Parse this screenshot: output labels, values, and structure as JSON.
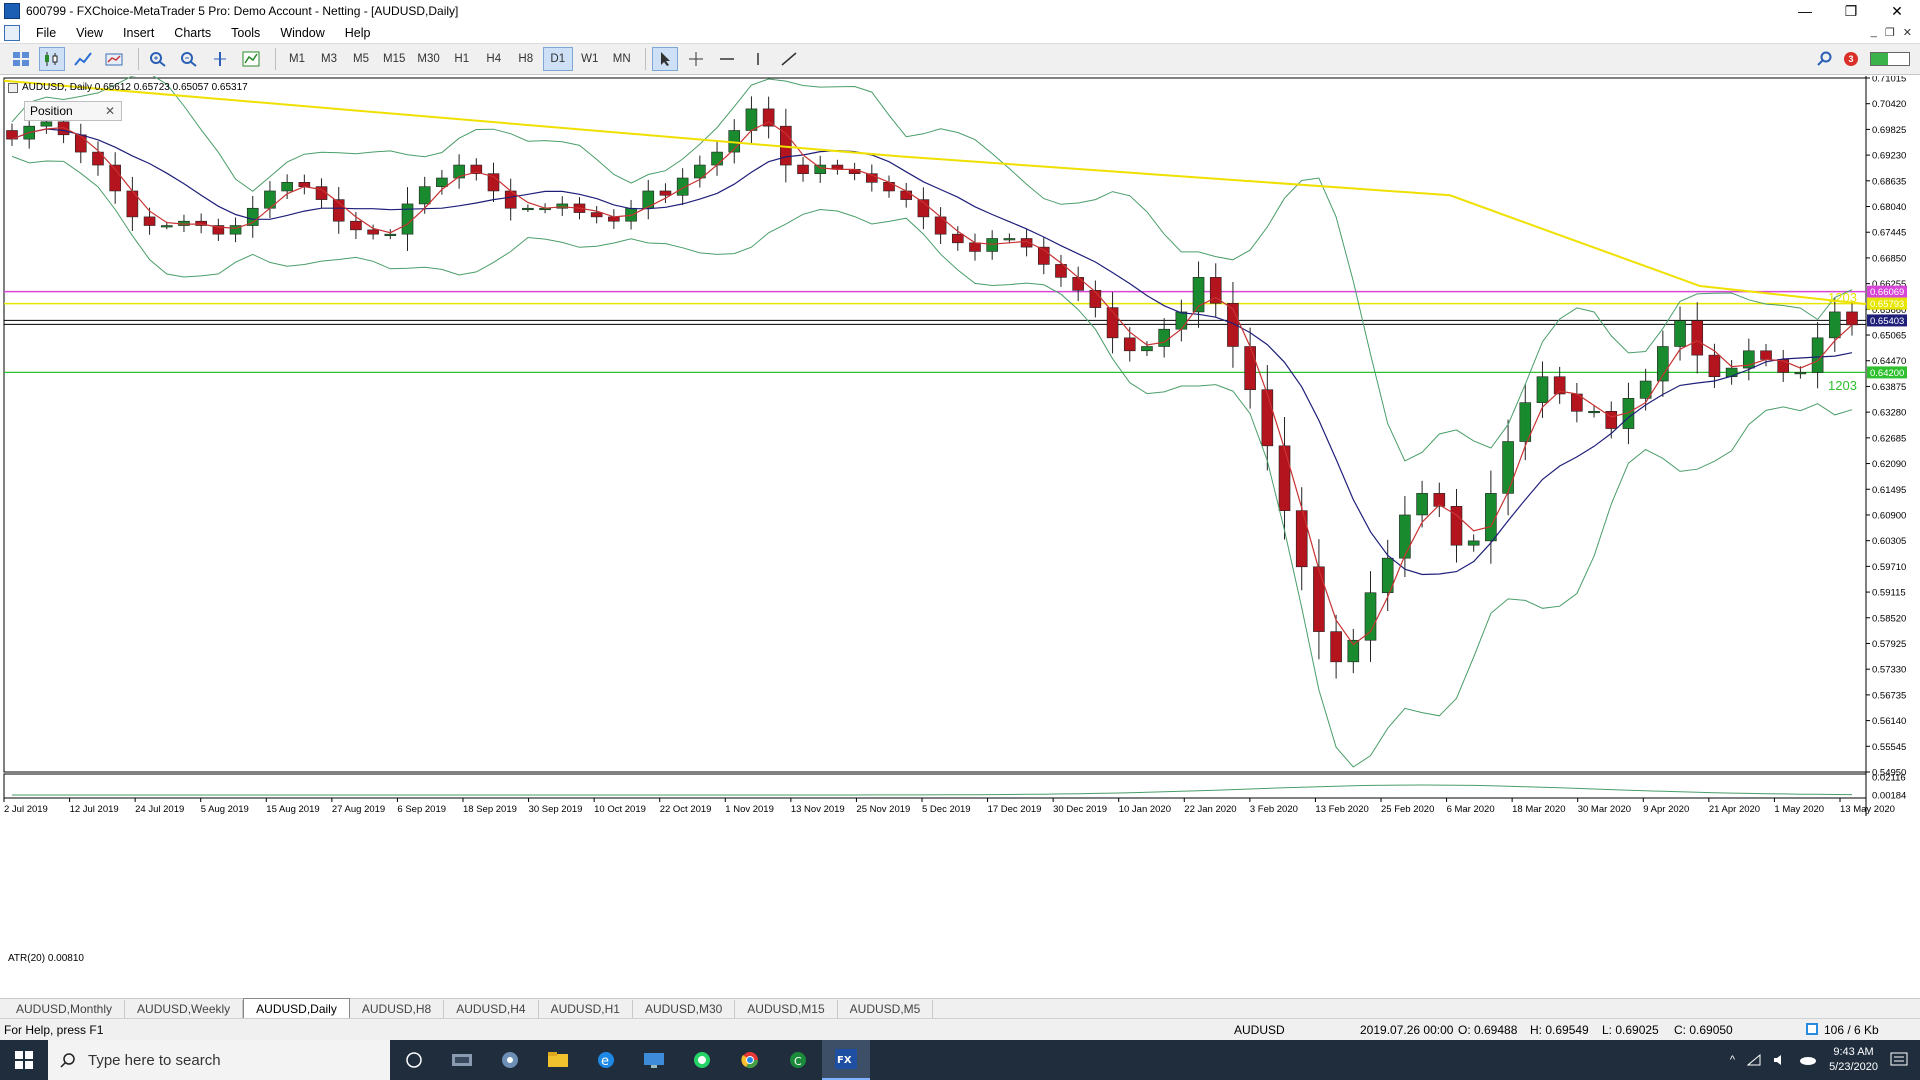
{
  "window": {
    "title": "600799 - FXChoice-MetaTrader 5 Pro: Demo Account - Netting - [AUDUSD,Daily]",
    "minimize": "—",
    "restore": "❐",
    "close": "✕"
  },
  "menu": {
    "items": [
      "File",
      "View",
      "Insert",
      "Charts",
      "Tools",
      "Window",
      "Help"
    ],
    "mdi_min": "_",
    "mdi_restore": "❐",
    "mdi_close": "✕"
  },
  "toolbar": {
    "timeframes": [
      "M1",
      "M3",
      "M5",
      "M15",
      "M30",
      "H1",
      "H4",
      "H8",
      "D1",
      "W1",
      "MN"
    ],
    "active_timeframe": "D1",
    "notification_count": "3"
  },
  "chart": {
    "header": "AUDUSD, Daily  0.65612 0.65723 0.65057 0.65317",
    "position_panel_label": "Position",
    "indicator_label": "ATR(20) 0.00810",
    "level_label_upper": "1203",
    "level_label_lower": "1203",
    "colors": {
      "bull": "#1a8a2e",
      "bear": "#b3141e",
      "ma_fast": "#c83232",
      "ma_slow": "#1f1f7a",
      "bands": "#4a9d6a",
      "ma_long": "#f0e000",
      "level_magenta": "#d846d8",
      "level_yellow": "#e6e600",
      "level_green": "#2ec02e",
      "level_price": "#000000"
    }
  },
  "chart_data": {
    "type": "candlestick",
    "symbol": "AUDUSD",
    "timeframe": "Daily",
    "y_ticks": [
      "0.71015",
      "0.70420",
      "0.69825",
      "0.69230",
      "0.68635",
      "0.68040",
      "0.67445",
      "0.66850",
      "0.66255",
      "0.65660",
      "0.65065",
      "0.64470",
      "0.63875",
      "0.63280",
      "0.62685",
      "0.62090",
      "0.61495",
      "0.60900",
      "0.60305",
      "0.59710",
      "0.59115",
      "0.58520",
      "0.57925",
      "0.57330",
      "0.56735",
      "0.56140",
      "0.55545",
      "0.54950"
    ],
    "price_tags": [
      {
        "label": "0.66069",
        "value": 0.66069,
        "color": "#d846d8"
      },
      {
        "label": "0.65793",
        "value": 0.65793,
        "color": "#e6e600"
      },
      {
        "label": "0.65403",
        "value": 0.65403,
        "color": "#1f1f7a"
      },
      {
        "label": "0.64200",
        "value": 0.642,
        "color": "#2ec02e"
      }
    ],
    "atr_ticks": [
      "0.02116",
      "0.00184"
    ],
    "x_ticks": [
      "2 Jul 2019",
      "12 Jul 2019",
      "24 Jul 2019",
      "5 Aug 2019",
      "15 Aug 2019",
      "27 Aug 2019",
      "6 Sep 2019",
      "18 Sep 2019",
      "30 Sep 2019",
      "10 Oct 2019",
      "22 Oct 2019",
      "1 Nov 2019",
      "13 Nov 2019",
      "25 Nov 2019",
      "5 Dec 2019",
      "17 Dec 2019",
      "30 Dec 2019",
      "10 Jan 2020",
      "22 Jan 2020",
      "3 Feb 2020",
      "13 Feb 2020",
      "25 Feb 2020",
      "6 Mar 2020",
      "18 Mar 2020",
      "30 Mar 2020",
      "9 Apr 2020",
      "21 Apr 2020",
      "1 May 2020",
      "13 May 2020"
    ],
    "close_path": [
      0.696,
      0.699,
      0.7,
      0.697,
      0.693,
      0.69,
      0.684,
      0.678,
      0.676,
      0.676,
      0.677,
      0.676,
      0.674,
      0.676,
      0.68,
      0.684,
      0.686,
      0.685,
      0.682,
      0.677,
      0.675,
      0.674,
      0.674,
      0.681,
      0.685,
      0.687,
      0.69,
      0.688,
      0.684,
      0.68,
      0.68,
      0.68,
      0.681,
      0.679,
      0.678,
      0.677,
      0.68,
      0.684,
      0.683,
      0.687,
      0.69,
      0.693,
      0.698,
      0.703,
      0.699,
      0.69,
      0.688,
      0.69,
      0.689,
      0.688,
      0.686,
      0.684,
      0.682,
      0.678,
      0.674,
      0.672,
      0.67,
      0.673,
      0.673,
      0.671,
      0.667,
      0.664,
      0.661,
      0.657,
      0.65,
      0.647,
      0.648,
      0.652,
      0.656,
      0.664,
      0.658,
      0.648,
      0.638,
      0.625,
      0.61,
      0.597,
      0.582,
      0.575,
      0.58,
      0.591,
      0.599,
      0.609,
      0.614,
      0.611,
      0.602,
      0.603,
      0.614,
      0.626,
      0.635,
      0.641,
      0.637,
      0.633,
      0.633,
      0.629,
      0.636,
      0.64,
      0.648,
      0.654,
      0.646,
      0.641,
      0.643,
      0.647,
      0.645,
      0.642,
      0.642,
      0.65,
      0.656,
      0.653
    ]
  },
  "tabs": [
    "AUDUSD,Monthly",
    "AUDUSD,Weekly",
    "AUDUSD,Daily",
    "AUDUSD,H8",
    "AUDUSD,H4",
    "AUDUSD,H1",
    "AUDUSD,M30",
    "AUDUSD,M15",
    "AUDUSD,M5"
  ],
  "active_tab": "AUDUSD,Daily",
  "status": {
    "help": "For Help, press F1",
    "symbol": "AUDUSD",
    "datetime": "2019.07.26 00:00",
    "open": "O: 0.69488",
    "high": "H: 0.69549",
    "low": "L: 0.69025",
    "close": "C: 0.69050",
    "traffic": "106 / 6 Kb"
  },
  "taskbar": {
    "search_placeholder": "Type here to search",
    "time": "9:43 AM",
    "date": "5/23/2020"
  }
}
